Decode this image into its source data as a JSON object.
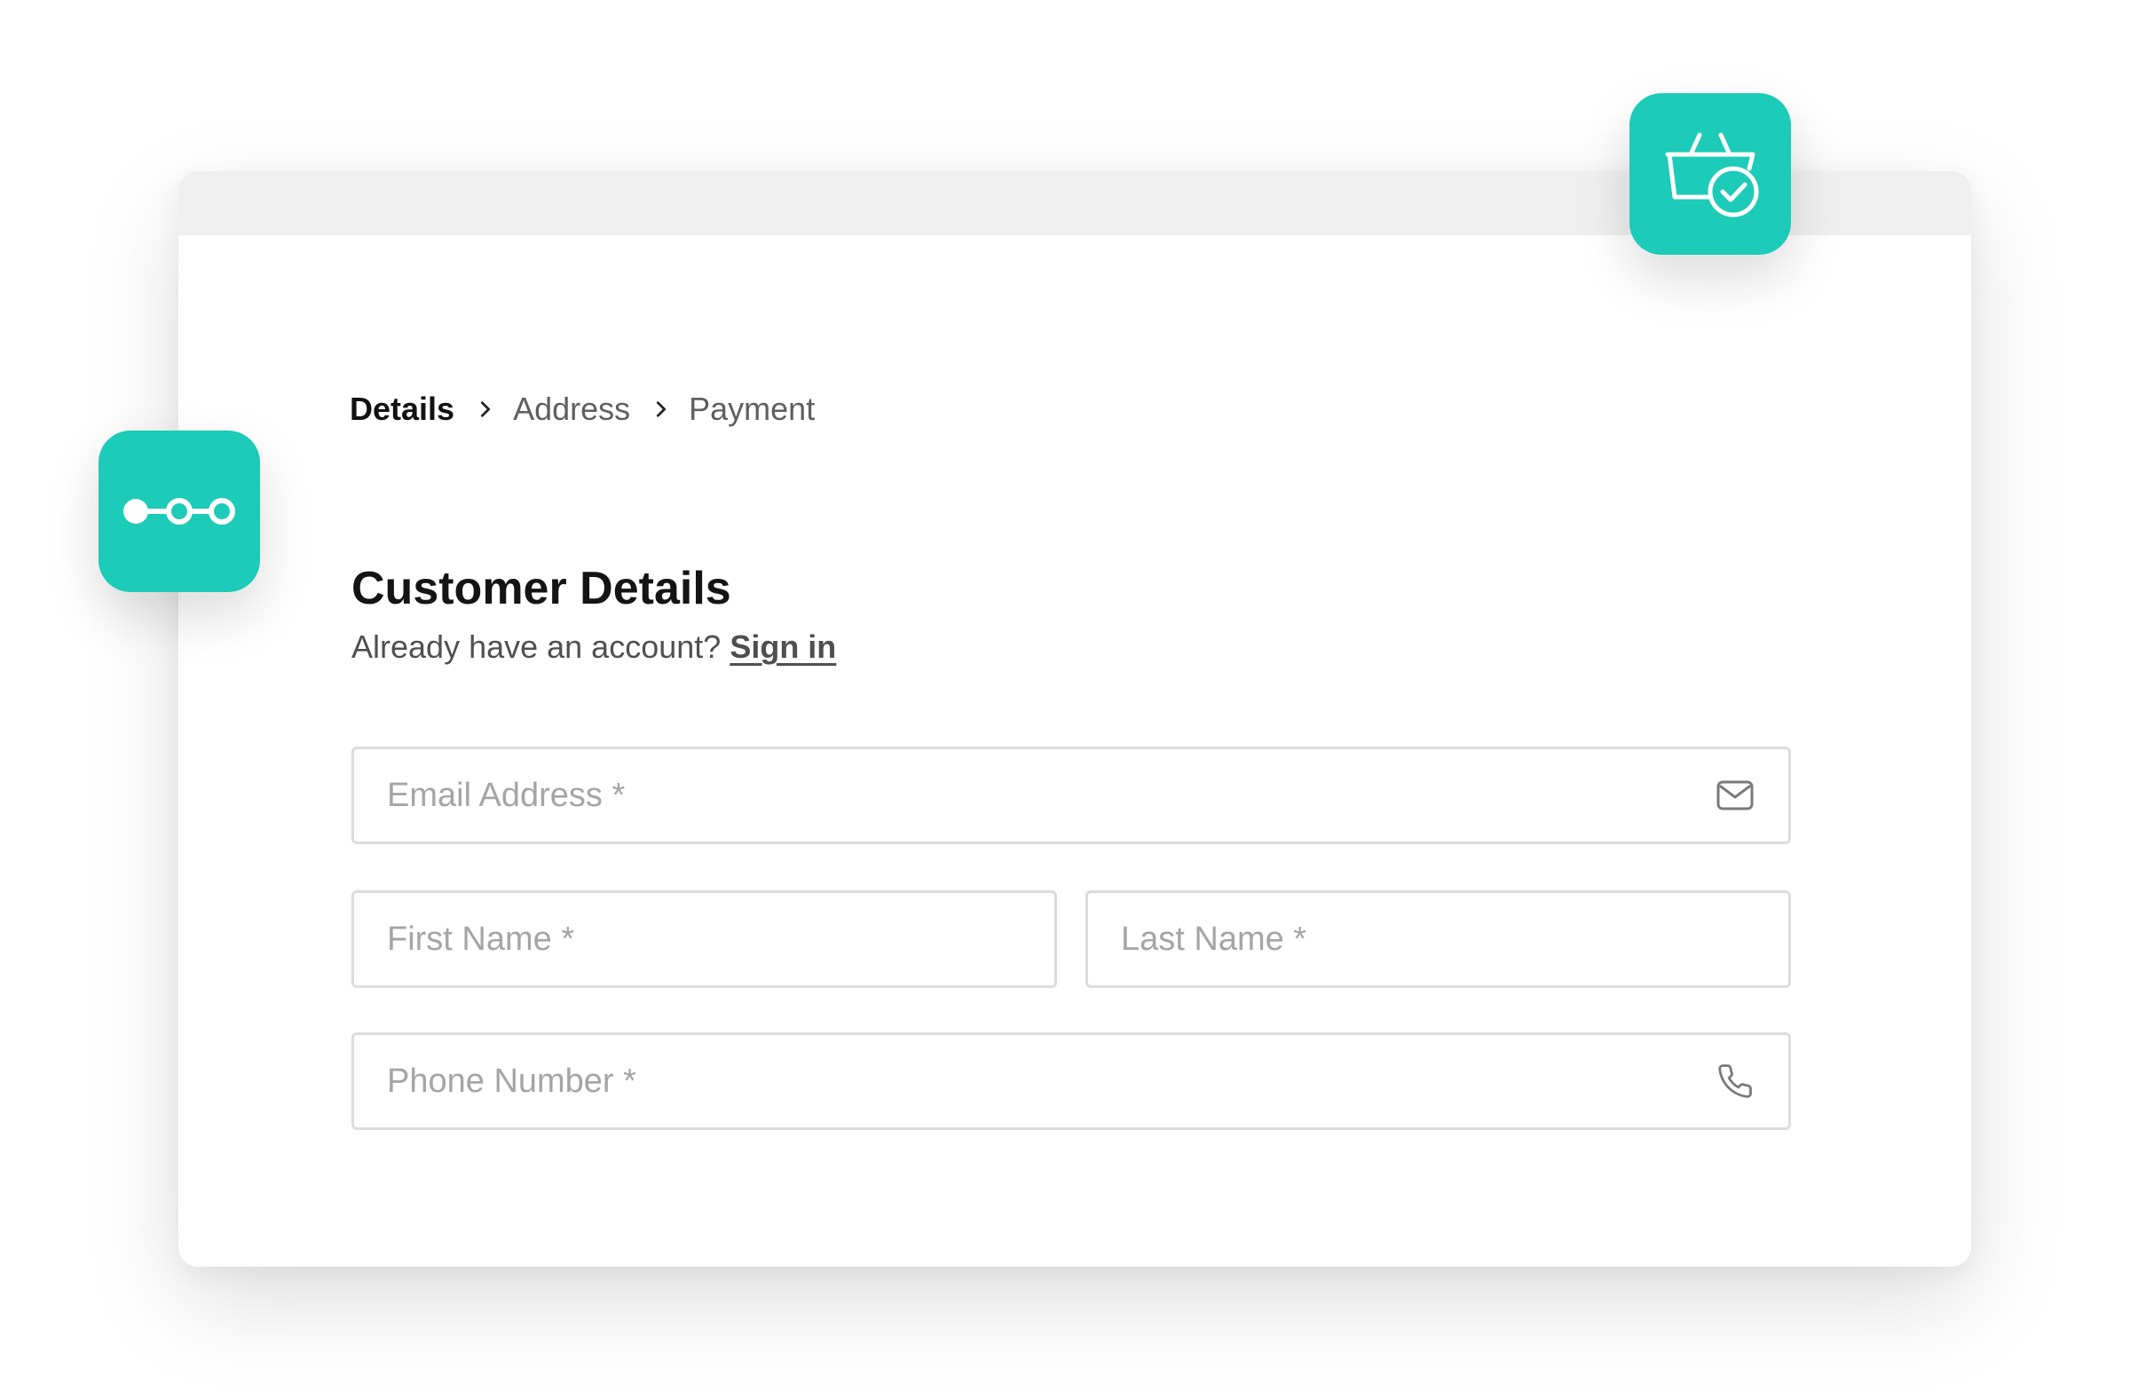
{
  "breadcrumb": {
    "steps": [
      {
        "label": "Details",
        "active": true
      },
      {
        "label": "Address",
        "active": false
      },
      {
        "label": "Payment",
        "active": false
      }
    ]
  },
  "form": {
    "title": "Customer Details",
    "subtitle": "Already have an account?",
    "signin_label": "Sign in",
    "fields": {
      "email": {
        "placeholder": "Email Address *",
        "value": ""
      },
      "first_name": {
        "placeholder": "First Name *",
        "value": ""
      },
      "last_name": {
        "placeholder": "Last Name *",
        "value": ""
      },
      "phone": {
        "placeholder": "Phone Number *",
        "value": ""
      }
    }
  },
  "icons": {
    "steps_badge": "progress-steps-icon",
    "basket_badge": "basket-check-icon",
    "email": "envelope-icon",
    "phone": "phone-icon",
    "separator": "chevron-right-icon"
  },
  "colors": {
    "accent": "#1ccbb8",
    "window_bar": "#efefef",
    "field_border": "#dcdcdc",
    "placeholder": "#a5a5a5",
    "text_primary": "#141414",
    "text_secondary": "#5f5f5f"
  }
}
